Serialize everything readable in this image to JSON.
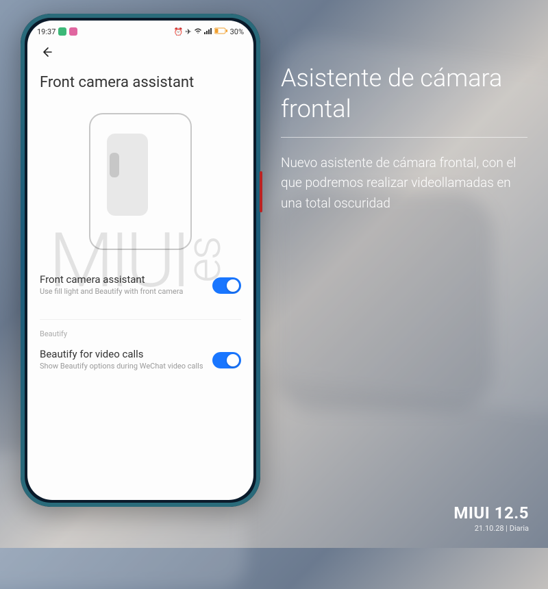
{
  "status_bar": {
    "time": "19:37",
    "battery_percent": "30%"
  },
  "header": {
    "title": "Front camera assistant"
  },
  "rows": {
    "main": {
      "title": "Front camera assistant",
      "subtitle": "Use fill light and Beautify with front camera",
      "enabled": true
    },
    "section_label": "Beautify",
    "beautify": {
      "title": "Beautify for video calls",
      "subtitle": "Show Beautify options during WeChat video calls",
      "enabled": true
    }
  },
  "watermark": {
    "main": "MIUI",
    "rot": "es"
  },
  "feature": {
    "title": "Asistente de cámara frontal",
    "desc": "Nuevo asistente de cámara frontal, con el que podremos realizar videollamadas en una total oscuridad"
  },
  "footer": {
    "brand": "MIUI 12.5",
    "meta": "21.10.28 | Diaria"
  }
}
